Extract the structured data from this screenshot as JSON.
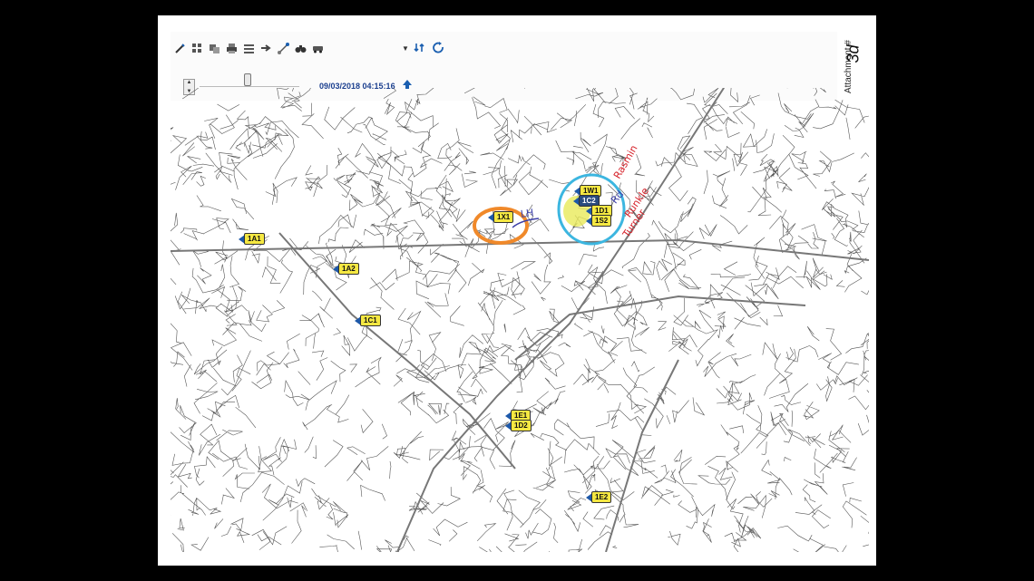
{
  "toolbar": {
    "timestamp": "09/03/2018 04:15:16",
    "icons": [
      "edit-icon",
      "grid-icon",
      "layers-icon",
      "print-icon",
      "list-icon",
      "arrow-right-icon",
      "route-icon",
      "binoculars-icon",
      "vehicle-icon",
      "swap-icon",
      "refresh-icon"
    ]
  },
  "attachment": {
    "label": "Attachment #",
    "number": "3d"
  },
  "units": [
    {
      "id": "1A1"
    },
    {
      "id": "1A2"
    },
    {
      "id": "1C1"
    },
    {
      "id": "1X1"
    },
    {
      "id": "1W1"
    },
    {
      "id": "1C2"
    },
    {
      "id": "1D1"
    },
    {
      "id": "1S2"
    },
    {
      "id": "1E1"
    },
    {
      "id": "1D2"
    },
    {
      "id": "1E2"
    }
  ],
  "annotations": {
    "near_1x1": "LH",
    "handwritten_1": "Rasmin",
    "handwritten_2": "Rd",
    "handwritten_3": "Runkle",
    "handwritten_4": "Turner"
  },
  "colors": {
    "marker_fill": "#f5e842",
    "marker_arrow": "#1d58a8",
    "orange_circle": "#f0892a",
    "cyan_circle": "#3cb6e0",
    "red_ink": "#d6232b",
    "blue_ink": "#3c3fa8"
  }
}
